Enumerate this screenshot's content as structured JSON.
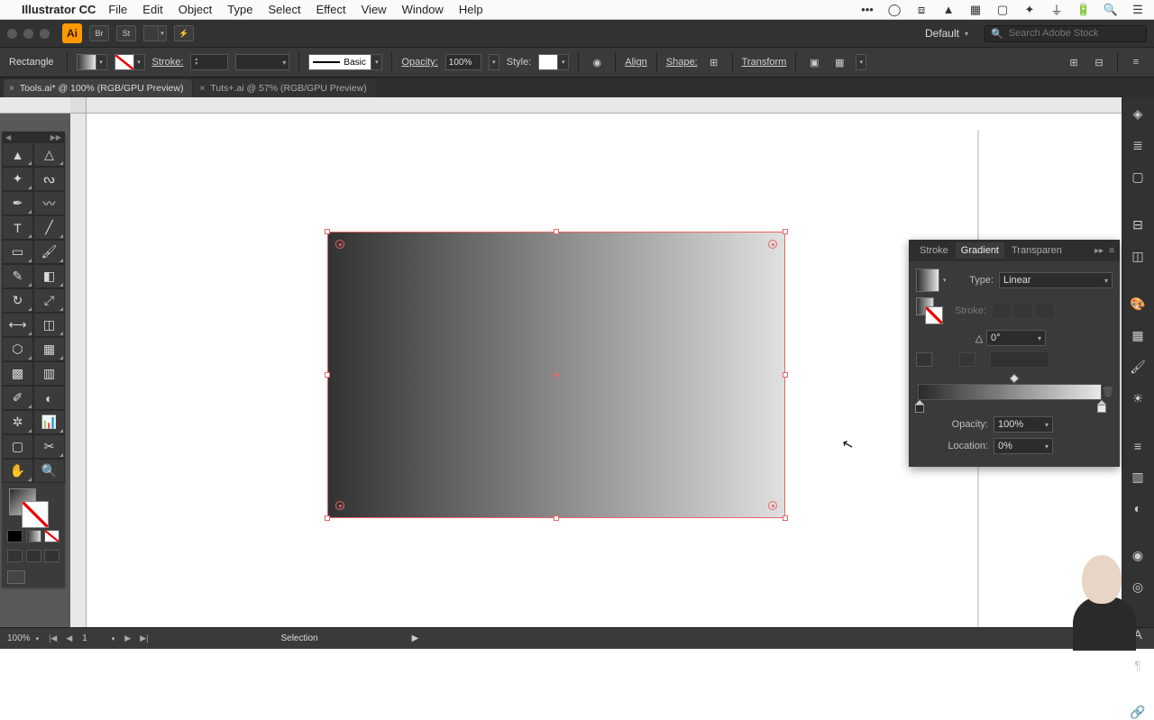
{
  "mac": {
    "app_name": "Illustrator CC",
    "menus": [
      "File",
      "Edit",
      "Object",
      "Type",
      "Select",
      "Effect",
      "View",
      "Window",
      "Help"
    ],
    "battery": "🔋"
  },
  "titlebar": {
    "workspace": "Default",
    "search_placeholder": "Search Adobe Stock"
  },
  "controlbar": {
    "object": "Rectangle",
    "stroke_label": "Stroke:",
    "brush_label": "Basic",
    "opacity_label": "Opacity:",
    "opacity_val": "100%",
    "style_label": "Style:",
    "align_label": "Align",
    "shape_label": "Shape:",
    "transform_label": "Transform"
  },
  "tabs": [
    {
      "label": "Tools.ai* @ 100% (RGB/GPU Preview)",
      "active": true
    },
    {
      "label": "Tuts+.ai @ 57% (RGB/GPU Preview)",
      "active": false
    }
  ],
  "panel": {
    "tabs": [
      "Stroke",
      "Gradient",
      "Transparen"
    ],
    "type_label": "Type:",
    "type_value": "Linear",
    "stroke_label": "Stroke:",
    "angle_value": "0°",
    "opacity_label": "Opacity:",
    "opacity_value": "100%",
    "location_label": "Location:",
    "location_value": "0%"
  },
  "status": {
    "zoom": "100%",
    "artboard": "1",
    "tool": "Selection"
  }
}
